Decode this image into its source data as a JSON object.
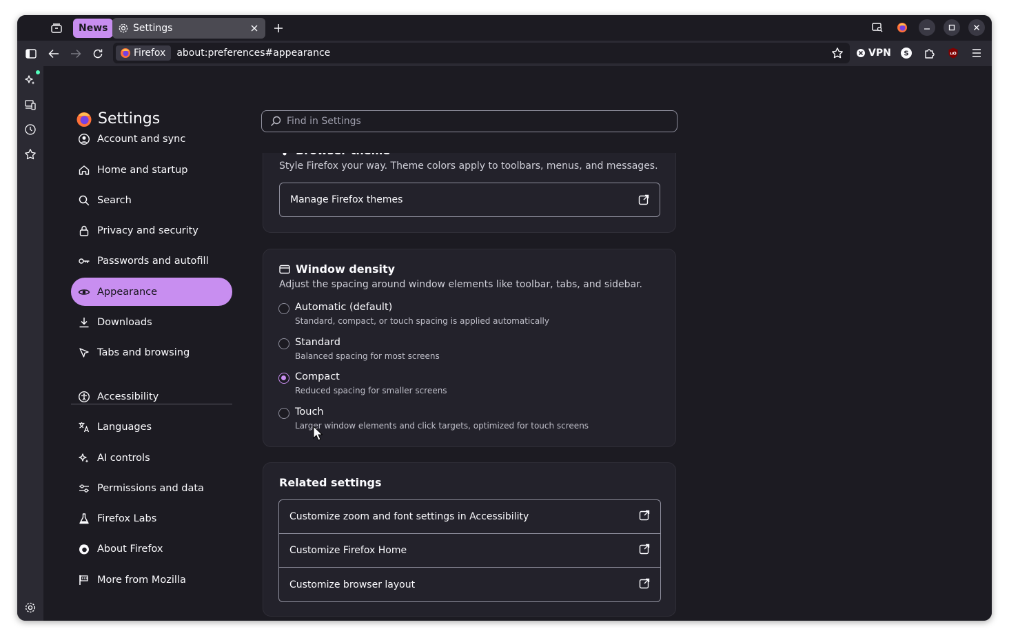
{
  "tabstrip": {
    "group_label": "News",
    "tab_title": "Settings"
  },
  "navbar": {
    "identity_label": "Firefox",
    "url": "about:preferences#appearance",
    "vpn_label": "VPN"
  },
  "page": {
    "title": "Settings",
    "search_placeholder": "Find in Settings"
  },
  "categories": [
    {
      "label": "Account and sync",
      "icon": "account-icon"
    },
    {
      "label": "Home and startup",
      "icon": "home-icon"
    },
    {
      "label": "Search",
      "icon": "search-icon"
    },
    {
      "label": "Privacy and security",
      "icon": "lock-icon"
    },
    {
      "label": "Passwords and autofill",
      "icon": "key-icon"
    },
    {
      "label": "Appearance",
      "icon": "eye-icon",
      "active": true
    },
    {
      "label": "Downloads",
      "icon": "download-icon"
    },
    {
      "label": "Tabs and browsing",
      "icon": "cursor-tab-icon"
    },
    {
      "label": "Accessibility",
      "icon": "accessibility-icon"
    },
    {
      "label": "Languages",
      "icon": "translate-icon"
    },
    {
      "label": "AI controls",
      "icon": "sparkle-icon"
    },
    {
      "label": "Permissions and data",
      "icon": "sliders-icon"
    },
    {
      "label": "Firefox Labs",
      "icon": "flask-icon"
    },
    {
      "label": "About Firefox",
      "icon": "firefox-icon"
    },
    {
      "label": "More from Mozilla",
      "icon": "mozilla-flag-icon"
    }
  ],
  "browser_theme": {
    "heading": "Browser theme",
    "description": "Style Firefox your way. Theme colors apply to toolbars, menus, and messages.",
    "manage_label": "Manage Firefox themes"
  },
  "window_density": {
    "heading": "Window density",
    "description": "Adjust the spacing around window elements like toolbar, tabs, and sidebar.",
    "options": [
      {
        "label": "Automatic (default)",
        "sub": "Standard, compact, or touch spacing is applied automatically",
        "checked": false
      },
      {
        "label": "Standard",
        "sub": "Balanced spacing for most screens",
        "checked": false
      },
      {
        "label": "Compact",
        "sub": "Reduced spacing for smaller screens",
        "checked": true
      },
      {
        "label": "Touch",
        "sub": "Larger window elements and click targets, optimized for touch screens",
        "checked": false
      }
    ]
  },
  "related": {
    "heading": "Related settings",
    "items": [
      "Customize zoom and font settings in Accessibility",
      "Customize Firefox Home",
      "Customize browser layout"
    ]
  },
  "colors": {
    "accent": "#c88ef0",
    "background": "#1c1b22",
    "card": "#23222b"
  }
}
